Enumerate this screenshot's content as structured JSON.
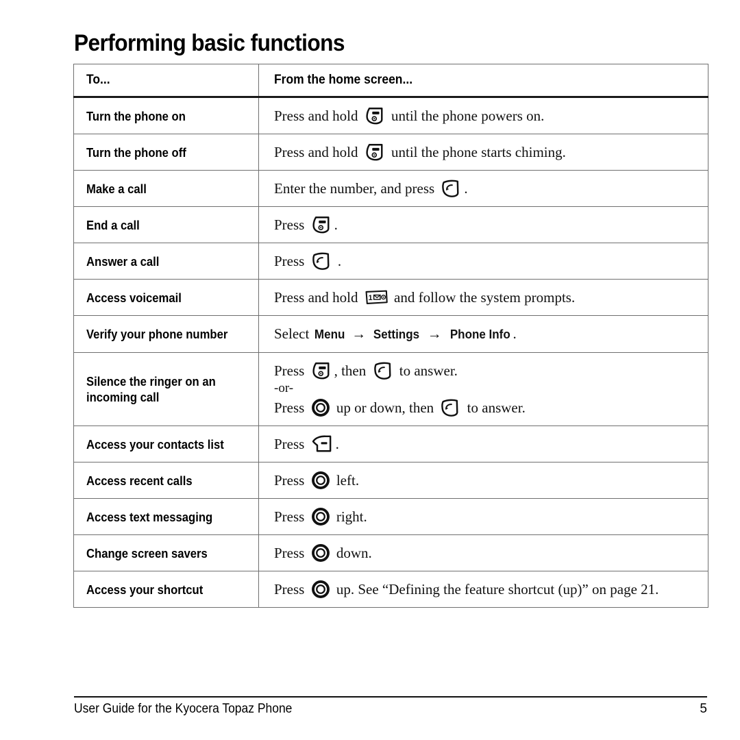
{
  "document": {
    "title": "Performing basic functions"
  },
  "table": {
    "headers": [
      "To...",
      "From the home screen..."
    ],
    "rows": [
      {
        "to": "Turn the phone on",
        "action": {
          "segments": [
            {
              "type": "text",
              "value": "Press and hold "
            },
            {
              "type": "icon",
              "icon": "end-key-icon"
            },
            {
              "type": "text",
              "value": " until the phone powers on."
            }
          ]
        }
      },
      {
        "to": "Turn the phone off",
        "action": {
          "segments": [
            {
              "type": "text",
              "value": "Press and hold "
            },
            {
              "type": "icon",
              "icon": "end-key-icon"
            },
            {
              "type": "text",
              "value": " until the phone starts chiming."
            }
          ]
        }
      },
      {
        "to": "Make a call",
        "action": {
          "segments": [
            {
              "type": "text",
              "value": "Enter the number, and press "
            },
            {
              "type": "icon",
              "icon": "send-key-icon"
            },
            {
              "type": "text",
              "value": "."
            }
          ]
        }
      },
      {
        "to": "End a call",
        "action": {
          "segments": [
            {
              "type": "text",
              "value": "Press "
            },
            {
              "type": "icon",
              "icon": "end-key-icon"
            },
            {
              "type": "text",
              "value": "."
            }
          ]
        }
      },
      {
        "to": "Answer a call",
        "action": {
          "segments": [
            {
              "type": "text",
              "value": "Press "
            },
            {
              "type": "icon",
              "icon": "send-key-icon"
            },
            {
              "type": "text",
              "value": " ."
            }
          ]
        }
      },
      {
        "to": "Access voicemail",
        "action": {
          "segments": [
            {
              "type": "text",
              "value": "Press and hold "
            },
            {
              "type": "icon",
              "icon": "voicemail-key-icon"
            },
            {
              "type": "text",
              "value": " and follow the system prompts."
            }
          ]
        }
      },
      {
        "to": "Verify your phone number",
        "action": {
          "segments": [
            {
              "type": "text",
              "value": "Select "
            },
            {
              "type": "menu",
              "value": "Menu"
            },
            {
              "type": "arrow",
              "value": "→"
            },
            {
              "type": "menu",
              "value": "Settings"
            },
            {
              "type": "arrow",
              "value": "→"
            },
            {
              "type": "menu",
              "value": "Phone Info"
            },
            {
              "type": "text",
              "value": "."
            }
          ]
        }
      },
      {
        "to": "Silence the ringer on an incoming call",
        "action": {
          "lines": [
            {
              "segments": [
                {
                  "type": "text",
                  "value": "Press "
                },
                {
                  "type": "icon",
                  "icon": "end-key-icon"
                },
                {
                  "type": "text",
                  "value": ", then "
                },
                {
                  "type": "icon",
                  "icon": "send-key-icon"
                },
                {
                  "type": "text",
                  "value": " to answer."
                }
              ]
            },
            {
              "or": "-or-"
            },
            {
              "segments": [
                {
                  "type": "text",
                  "value": "Press "
                },
                {
                  "type": "icon",
                  "icon": "navigation-key-icon"
                },
                {
                  "type": "text",
                  "value": " up or down, then "
                },
                {
                  "type": "icon",
                  "icon": "send-key-icon"
                },
                {
                  "type": "text",
                  "value": " to answer."
                }
              ]
            }
          ]
        }
      },
      {
        "to": "Access your contacts list",
        "action": {
          "segments": [
            {
              "type": "text",
              "value": "Press "
            },
            {
              "type": "icon",
              "icon": "contacts-key-icon"
            },
            {
              "type": "text",
              "value": "."
            }
          ]
        }
      },
      {
        "to": "Access recent calls",
        "action": {
          "segments": [
            {
              "type": "text",
              "value": "Press "
            },
            {
              "type": "icon",
              "icon": "navigation-key-icon"
            },
            {
              "type": "text",
              "value": " left."
            }
          ]
        }
      },
      {
        "to": "Access text messaging",
        "action": {
          "segments": [
            {
              "type": "text",
              "value": "Press "
            },
            {
              "type": "icon",
              "icon": "navigation-key-icon"
            },
            {
              "type": "text",
              "value": " right."
            }
          ]
        }
      },
      {
        "to": "Change screen savers",
        "action": {
          "segments": [
            {
              "type": "text",
              "value": "Press "
            },
            {
              "type": "icon",
              "icon": "navigation-key-icon"
            },
            {
              "type": "text",
              "value": " down."
            }
          ]
        }
      },
      {
        "to": "Access your shortcut",
        "action": {
          "segments": [
            {
              "type": "text",
              "value": "Press "
            },
            {
              "type": "icon",
              "icon": "navigation-key-icon"
            },
            {
              "type": "text",
              "value": " up. See “Defining the feature shortcut (up)” on page 21."
            }
          ]
        }
      }
    ]
  },
  "footer": {
    "text": "User Guide for the Kyocera Topaz Phone",
    "page_number": "5"
  }
}
